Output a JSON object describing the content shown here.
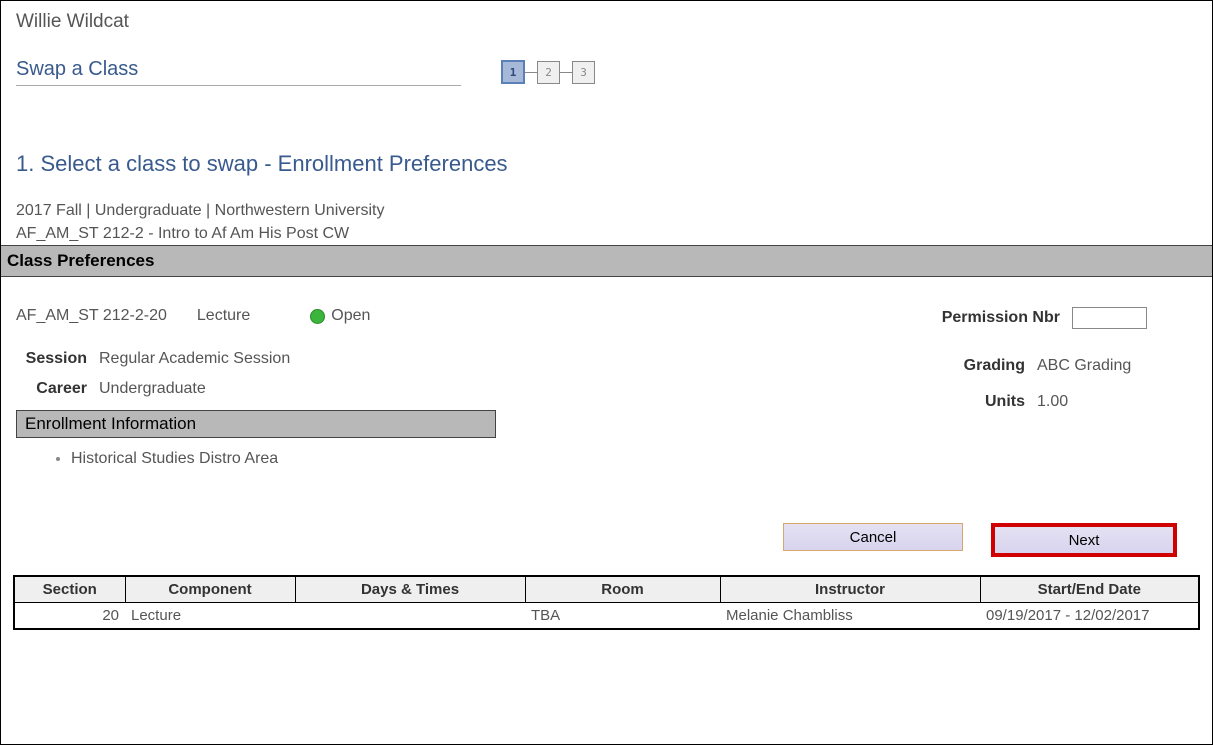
{
  "user_name": "Willie Wildcat",
  "page_title": "Swap a Class",
  "stepper": {
    "steps": [
      "1",
      "2",
      "3"
    ],
    "active_index": 0
  },
  "step_heading": "1.  Select a class to swap - Enrollment Preferences",
  "context_line": "2017 Fall | Undergraduate | Northwestern University",
  "class_line": "AF_AM_ST  212-2 - Intro to Af Am His Post CW",
  "class_prefs_title": "Class Preferences",
  "class_info": {
    "id": "AF_AM_ST  212-2-20",
    "component": "Lecture",
    "status": "Open"
  },
  "session": {
    "label": "Session",
    "value": "Regular Academic Session"
  },
  "career": {
    "label": "Career",
    "value": "Undergraduate"
  },
  "permission": {
    "label": "Permission Nbr",
    "value": ""
  },
  "grading": {
    "label": "Grading",
    "value": "ABC Grading"
  },
  "units": {
    "label": "Units",
    "value": "1.00"
  },
  "enroll_info_title": "Enrollment Information",
  "enroll_info_items": [
    "Historical Studies Distro Area"
  ],
  "buttons": {
    "cancel": "Cancel",
    "next": "Next"
  },
  "table": {
    "headers": [
      "Section",
      "Component",
      "Days & Times",
      "Room",
      "Instructor",
      "Start/End Date"
    ],
    "rows": [
      {
        "section": "20",
        "component": "Lecture",
        "days_times": "",
        "room": "TBA",
        "instructor": "Melanie Chambliss",
        "start_end": "09/19/2017 - 12/02/2017"
      }
    ]
  }
}
